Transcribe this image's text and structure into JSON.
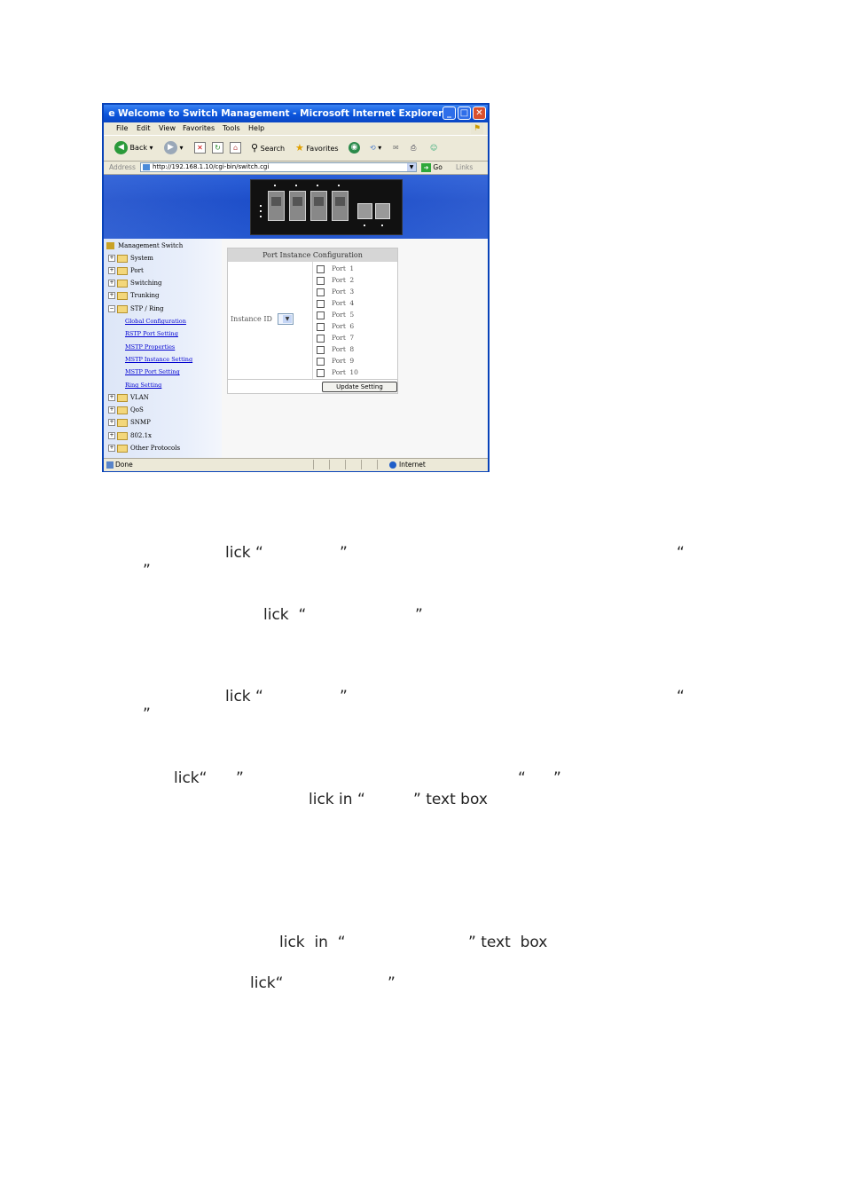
{
  "window": {
    "title": "Welcome to Switch Management - Microsoft Internet Explorer",
    "menu": [
      "File",
      "Edit",
      "View",
      "Favorites",
      "Tools",
      "Help"
    ],
    "toolbar": {
      "back_label": "Back",
      "search_label": "Search",
      "favorites_label": "Favorites"
    },
    "address": {
      "label": "Address",
      "url": "http://192.168.1.10/cgi-bin/switch.cgi",
      "go_label": "Go",
      "links_label": "Links"
    },
    "status": {
      "left": "Done",
      "zone": "Internet"
    }
  },
  "sidebar": {
    "root": "Management Switch",
    "items": [
      {
        "label": "System"
      },
      {
        "label": "Port"
      },
      {
        "label": "Switching"
      },
      {
        "label": "Trunking"
      },
      {
        "label": "STP / Ring"
      }
    ],
    "sub_items": [
      {
        "label": "Global Configuration"
      },
      {
        "label": "RSTP Port Setting"
      },
      {
        "label": "MSTP Properties"
      },
      {
        "label": "MSTP Instance Setting"
      },
      {
        "label": "MSTP Port Setting"
      },
      {
        "label": "Ring Setting"
      }
    ],
    "items_after": [
      {
        "label": "VLAN"
      },
      {
        "label": "QoS"
      },
      {
        "label": "SNMP"
      },
      {
        "label": "802.1x"
      },
      {
        "label": "Other Protocols"
      }
    ]
  },
  "panel": {
    "title": "Port Instance Configuration",
    "instance_label": "Instance ID",
    "port_word": "Port",
    "ports": [
      "1",
      "2",
      "3",
      "4",
      "5",
      "6",
      "7",
      "8",
      "9",
      "10"
    ],
    "update_button": "Update Setting"
  },
  "text_fragments": [
    {
      "id": "f1",
      "text": "lick “"
    },
    {
      "id": "f2",
      "text": "”"
    },
    {
      "id": "f3",
      "text": "“"
    },
    {
      "id": "f4",
      "text": "”"
    },
    {
      "id": "f5",
      "text": "lick  “"
    },
    {
      "id": "f6",
      "text": "”"
    },
    {
      "id": "f7",
      "text": "lick “"
    },
    {
      "id": "f8",
      "text": "”"
    },
    {
      "id": "f9",
      "text": "“"
    },
    {
      "id": "f10",
      "text": "”"
    },
    {
      "id": "f11",
      "text": "lick“"
    },
    {
      "id": "f12",
      "text": "”"
    },
    {
      "id": "f13",
      "text": "“"
    },
    {
      "id": "f14",
      "text": "”"
    },
    {
      "id": "f15",
      "text": "lick in “"
    },
    {
      "id": "f16",
      "text": "” text box"
    },
    {
      "id": "f17",
      "text": "lick  in  “"
    },
    {
      "id": "f18",
      "text": "” text  box"
    },
    {
      "id": "f19",
      "text": "lick“"
    },
    {
      "id": "f20",
      "text": "”"
    }
  ]
}
